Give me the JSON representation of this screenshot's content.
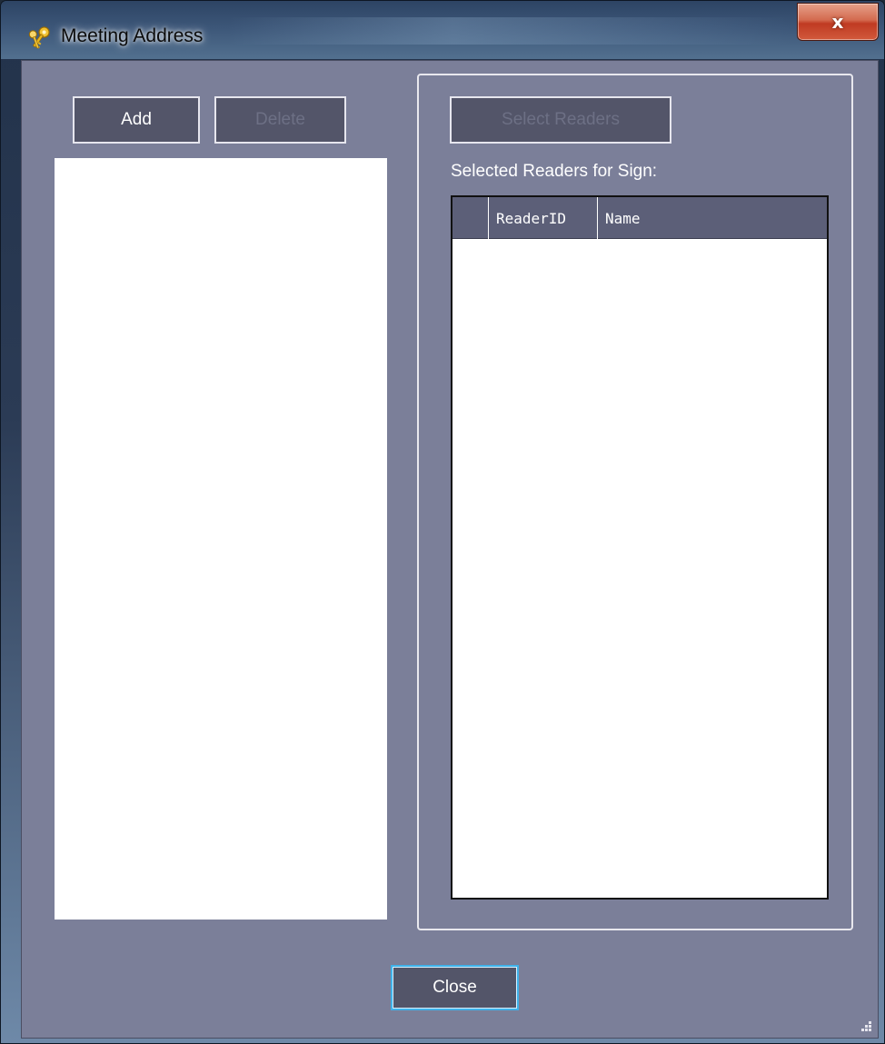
{
  "window": {
    "title": "Meeting Address",
    "close_glyph": "x",
    "app_icon": "key-icon",
    "accent_close": "#c8452b",
    "client_bg": "#7b7f99"
  },
  "left_panel": {
    "add_label": "Add",
    "delete_label": "Delete",
    "delete_enabled": false
  },
  "right_panel": {
    "select_readers_label": "Select Readers",
    "select_readers_enabled": false,
    "selected_label": "Selected Readers for Sign:",
    "grid": {
      "columns": [
        "",
        "ReaderID",
        "Name"
      ],
      "rows": []
    }
  },
  "footer": {
    "close_label": "Close"
  }
}
